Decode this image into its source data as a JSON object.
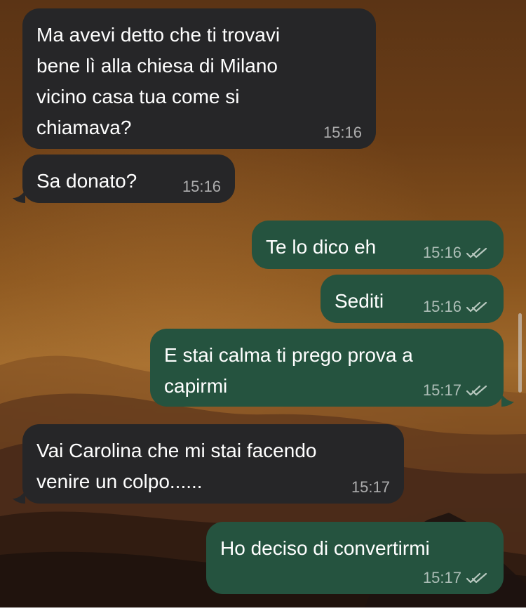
{
  "messages": [
    {
      "text": "Ma avevi detto che ti trovavi\nbene lì alla chiesa di Milano\nvicino casa tua come si\nchiamava?",
      "time": "15:16"
    },
    {
      "text": "Sa donato?",
      "time": "15:16"
    },
    {
      "text": "Te lo dico eh",
      "time": "15:16"
    },
    {
      "text": "Sediti",
      "time": "15:16"
    },
    {
      "text": "E stai calma ti prego prova a\ncapirmi",
      "time": "15:17"
    },
    {
      "text": "Vai Carolina che mi stai facendo\nvenire un colpo......",
      "time": "15:17"
    },
    {
      "text": "Ho deciso di convertirmi",
      "time": "15:17"
    }
  ],
  "colors": {
    "incoming_bubble": "#262628",
    "outgoing_bubble": "#25533f",
    "meta_text": "#b3b3b3"
  },
  "icons": {
    "read_receipt": "double-check-icon"
  }
}
